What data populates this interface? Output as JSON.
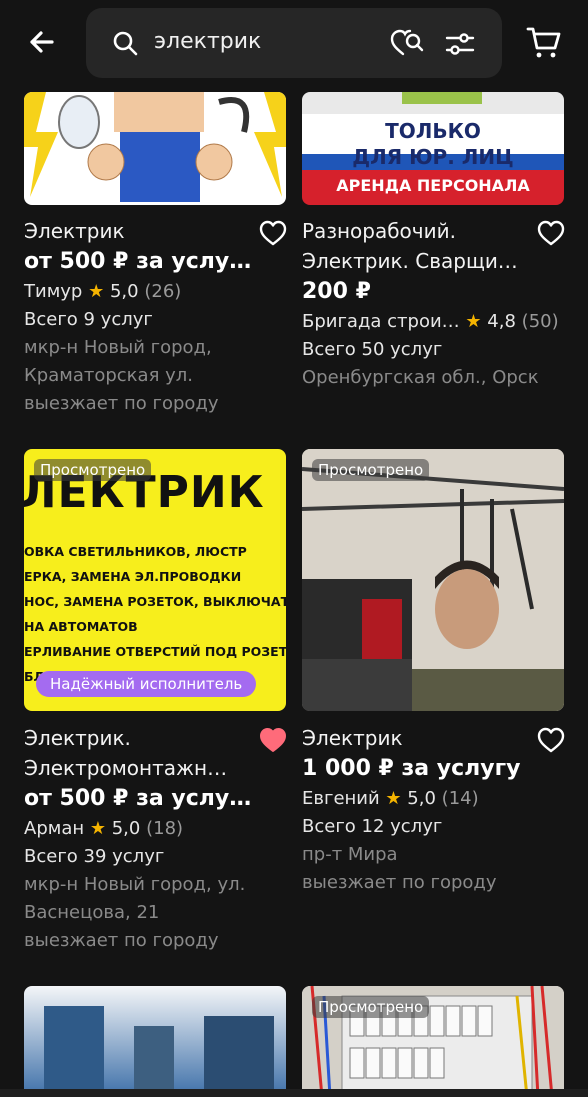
{
  "search": {
    "query": "электрик"
  },
  "cards": [
    {
      "title_lines": [
        "Электрик"
      ],
      "price": "от 500 ₽ за услу…",
      "seller": "Тимур",
      "rating": "5,0",
      "reviews": "(26)",
      "services": "Всего 9 услуг",
      "location_lines": [
        "мкр-н Новый город,",
        "Краматорская ул.",
        "выезжает по городу"
      ],
      "favorited": false,
      "image_text": []
    },
    {
      "title_lines": [
        "Разнорабочий.",
        "Электрик. Сварщи…"
      ],
      "price": "200 ₽",
      "seller": "Бригада строи…",
      "rating": "4,8",
      "reviews": "(50)",
      "services": "Всего 50 услуг",
      "location_lines": [
        "Оренбургская обл., Орск"
      ],
      "favorited": false,
      "image_text": [
        "ТОЛЬКО",
        "ДЛЯ ЮР. ЛИЦ",
        "АРЕНДА ПЕРСОНАЛА"
      ]
    },
    {
      "badge": "Просмотрено",
      "reliable": "Надёжный исполнитель",
      "title_lines": [
        "Электрик.",
        "Электромонтажн…"
      ],
      "price": "от 500 ₽ за услу…",
      "seller": "Арман",
      "rating": "5,0",
      "reviews": "(18)",
      "services": "Всего 39 услуг",
      "location_lines": [
        "мкр-н Новый город, ул.",
        "Васнецова, 21",
        "выезжает по городу"
      ],
      "favorited": true,
      "image_text": [
        "ЛЕКТРИК",
        "ОВКА СВЕТИЛЬНИКОВ, ЛЮСТР",
        "ЕРКА, ЗАМЕНА ЭЛ.ПРОВОДКИ",
        "НОС, ЗАМЕНА РОЗЕТОК, ВЫКЛЮЧАТЕЛЕ",
        "НА АВТОМАТОВ",
        "ЕРЛИВАНИЕ ОТВЕРСТИЙ ПОД РОЗЕТКИ",
        "БЛ"
      ]
    },
    {
      "badge": "Просмотрено",
      "title_lines": [
        "Электрик"
      ],
      "price": "1 000 ₽ за услугу",
      "seller": "Евгений",
      "rating": "5,0",
      "reviews": "(14)",
      "services": "Всего 12 услуг",
      "location_lines": [
        "пр-т Мира",
        "выезжает по городу"
      ],
      "favorited": false,
      "image_text": []
    },
    {
      "title_lines": [],
      "image_text": []
    },
    {
      "badge": "Просмотрено",
      "title_lines": [],
      "image_text": []
    }
  ],
  "colors": {
    "background": "#141414",
    "accent_star": "#f5b400",
    "heart_active": "#ff6b7a",
    "reliable_badge": "#a46bf0"
  }
}
